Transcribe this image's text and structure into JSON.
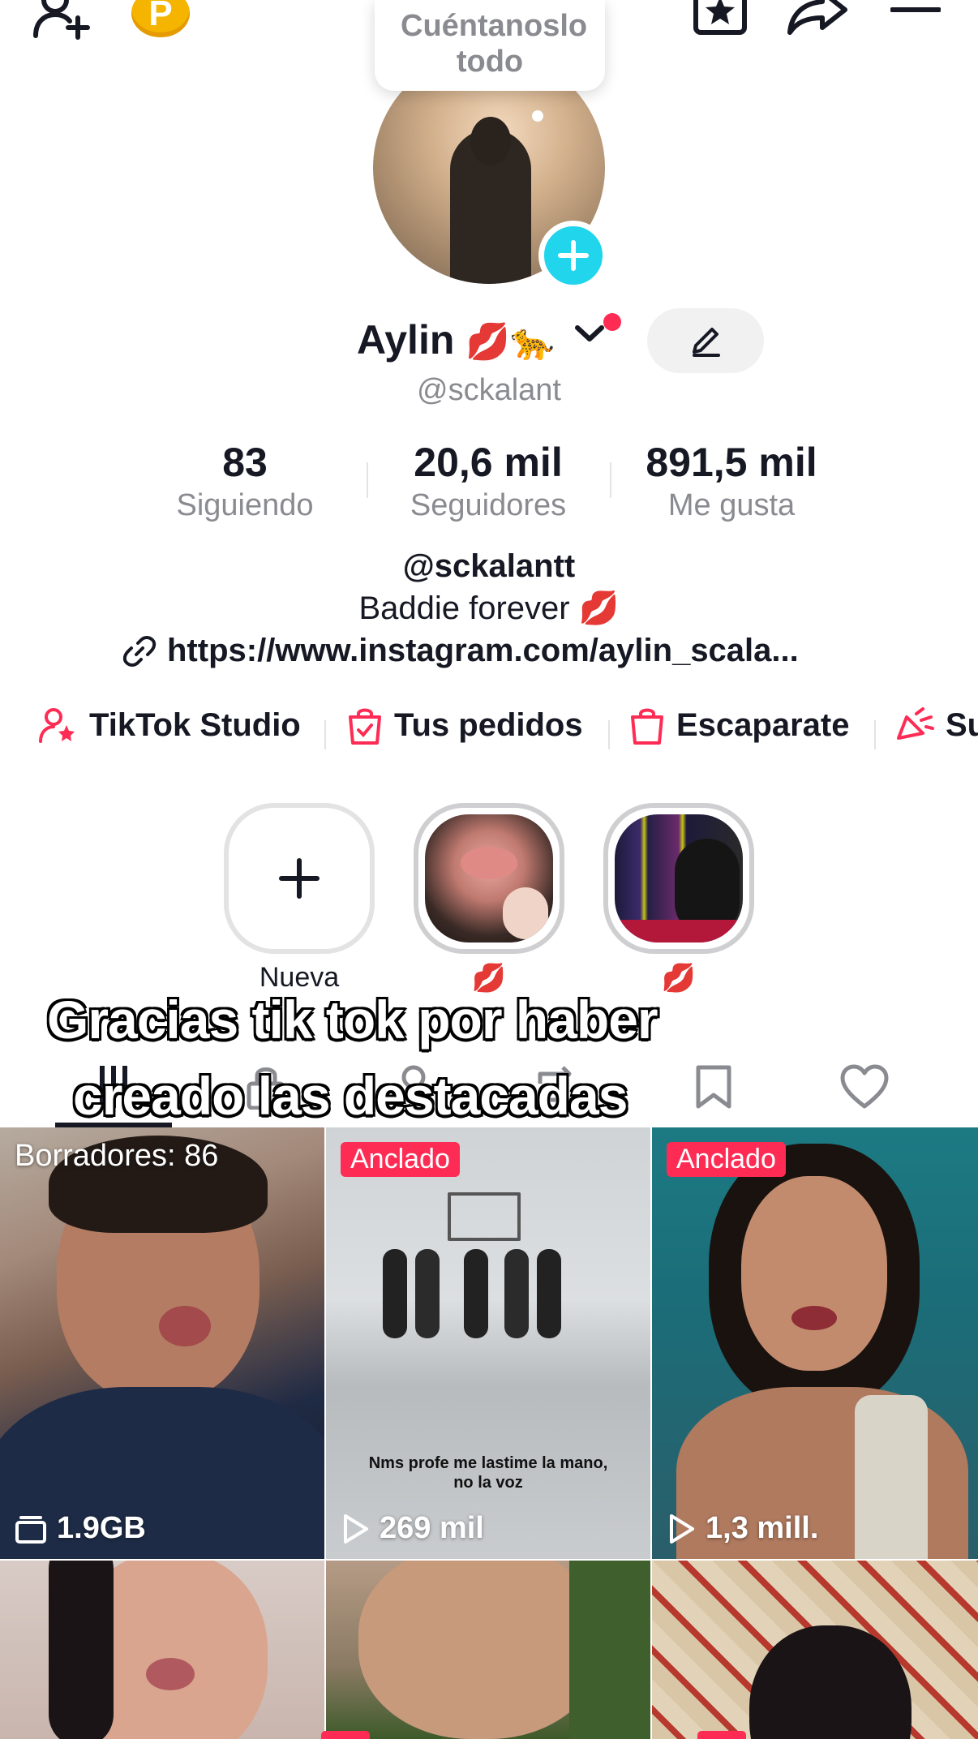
{
  "header": {
    "icons": [
      "add-friend-icon",
      "coin-icon",
      "favorites-icon",
      "share-icon",
      "menu-icon"
    ],
    "coin_letter": "P"
  },
  "profile": {
    "tooltip": "Cuéntanoslo todo",
    "display_name": "Aylin",
    "name_emojis": "💋🐆",
    "username": "@sckalant"
  },
  "stats": [
    {
      "value": "83",
      "label": "Siguiendo"
    },
    {
      "value": "20,6 mil",
      "label": "Seguidores"
    },
    {
      "value": "891,5 mil",
      "label": "Me gusta"
    }
  ],
  "bio": {
    "line1": "@sckalantt",
    "line2": "Baddie forever 💋",
    "link": "https://www.instagram.com/aylin_scala..."
  },
  "shortcuts": [
    {
      "label": "TikTok Studio",
      "icon": "creator-icon"
    },
    {
      "label": "Tus pedidos",
      "icon": "orders-icon"
    },
    {
      "label": "Escaparate",
      "icon": "shop-bag-icon"
    },
    {
      "label": "Su",
      "icon": "promote-icon"
    }
  ],
  "highlights": [
    {
      "label": "Nueva",
      "type": "new"
    },
    {
      "label": "💋",
      "type": "story"
    },
    {
      "label": "💋",
      "type": "story"
    }
  ],
  "overlay_caption": {
    "line1": "Gracias tik tok por haber",
    "line2": "creado las destacadas"
  },
  "tabs": [
    "grid-icon",
    "lock-icon",
    "repost-icon",
    "bookmark-icon",
    "heart-icon"
  ],
  "grid": [
    {
      "top_label": "Borradores: 86",
      "footer": "1.9GB",
      "footer_icon": "drafts-icon"
    },
    {
      "badge": "Anclado",
      "footer": "269 mil",
      "footer_icon": "play-icon",
      "overlay_text": "Nms profe me lastime la mano, no la voz"
    },
    {
      "badge": "Anclado",
      "footer": "1,3 mill.",
      "footer_icon": "play-icon"
    }
  ],
  "colors": {
    "accent": "#fe2c55",
    "cyan": "#20d5ec",
    "muted": "#8a8b91",
    "text": "#161823"
  }
}
